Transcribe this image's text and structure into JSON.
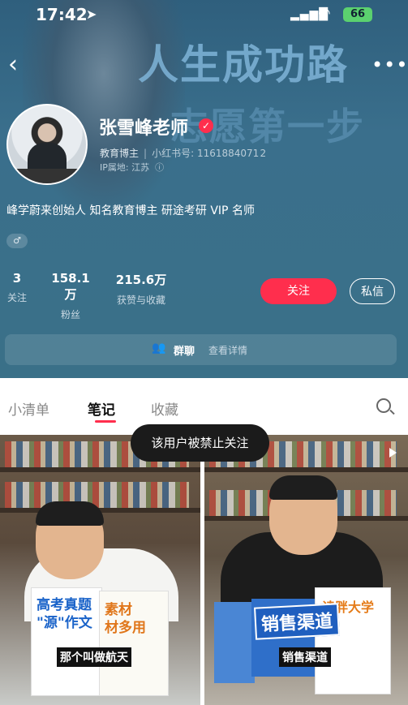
{
  "status_bar": {
    "time": "17:42",
    "battery": "66"
  },
  "banner": {
    "line1": "人生成功路",
    "line2": "志愿第一步"
  },
  "profile": {
    "name": "张雪峰老师",
    "role": "教育博主",
    "red_id_label": "小红书号:",
    "red_id": "1161884071 2",
    "ip_label": "IP属地:",
    "ip_value": "江苏",
    "bio": "峰学蔚来创始人 知名教育博主 研途考研 VIP 名师",
    "gender_badge": "♂"
  },
  "stats": [
    {
      "value": "3",
      "label": "关注"
    },
    {
      "value": "158.1万",
      "label": "粉丝"
    },
    {
      "value": "215.6万",
      "label": "获赞与收藏"
    }
  ],
  "buttons": {
    "follow": "关注",
    "message": "私信"
  },
  "group": {
    "label": "群聊",
    "detail": "查看详情"
  },
  "tabs": [
    {
      "label": "小清单"
    },
    {
      "label": "笔记"
    },
    {
      "label": "收藏"
    }
  ],
  "toast": "该用户被禁止关注",
  "notes": [
    {
      "book1_title": "高考真题\n\"源\"作文",
      "book2_title": "素材\n材多用",
      "caption": "那个叫做航天"
    },
    {
      "book_title": "读胖大学",
      "headline": "销售渠道",
      "caption": "销售渠道"
    }
  ],
  "colors": {
    "accent": "#ff2e4d",
    "header_bg": "#3a6f8c"
  }
}
